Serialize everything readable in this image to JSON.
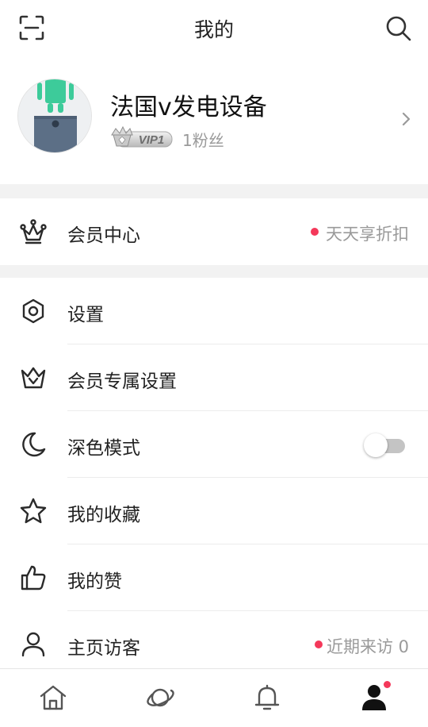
{
  "header": {
    "title": "我的",
    "left_icon": "scan-icon",
    "right_icon": "search-icon"
  },
  "profile": {
    "username": "法国v发电设备",
    "vip_label": "VIP1",
    "fans": "1粉丝",
    "avatar_icon": "android-avatar-icon"
  },
  "member_center": {
    "label": "会员中心",
    "promo": "天天享折扣",
    "icon": "crown-icon"
  },
  "menu": [
    {
      "label": "设置",
      "icon": "settings-hexagon-icon"
    },
    {
      "label": "会员专属设置",
      "icon": "crown-outline-icon"
    },
    {
      "label": "深色模式",
      "icon": "moon-icon",
      "toggle_on": false
    },
    {
      "label": "我的收藏",
      "icon": "star-icon"
    },
    {
      "label": "我的赞",
      "icon": "thumbs-up-icon"
    },
    {
      "label": "主页访客",
      "icon": "user-icon",
      "extra": "近期来访 0"
    }
  ],
  "tabbar": [
    {
      "icon": "home-icon",
      "active": false
    },
    {
      "icon": "planet-icon",
      "active": false
    },
    {
      "icon": "bell-icon",
      "active": false
    },
    {
      "icon": "profile-icon",
      "active": true,
      "badge": true
    }
  ],
  "colors": {
    "accent_dot": "#f4385a",
    "avatar_android": "#3dcb9a",
    "avatar_body": "#5c6f86"
  }
}
